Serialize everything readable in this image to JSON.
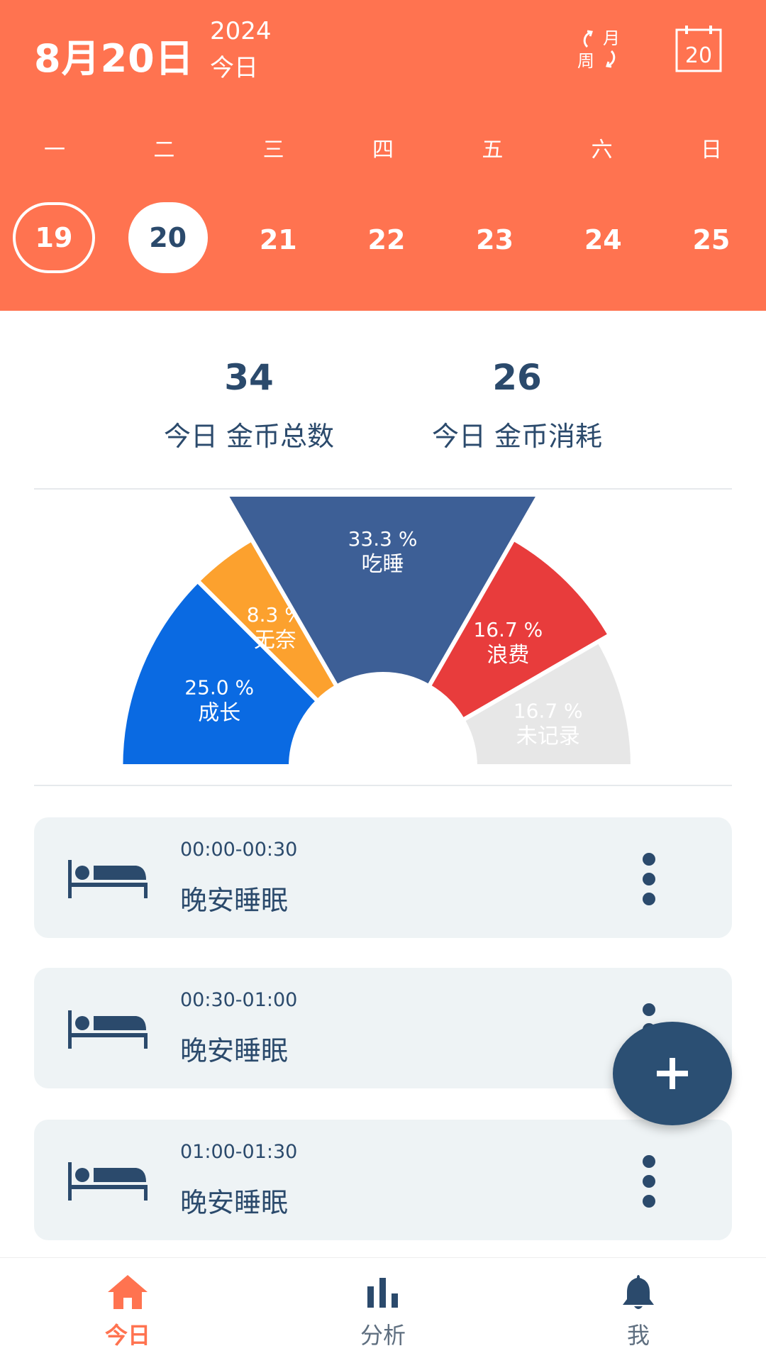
{
  "header": {
    "date": "8月20日",
    "year": "2024",
    "today": "今日",
    "switch_month": "月",
    "switch_week": "周",
    "calendar_day": "20",
    "weekdays": [
      "一",
      "二",
      "三",
      "四",
      "五",
      "六",
      "日"
    ],
    "dates": [
      "19",
      "20",
      "21",
      "22",
      "23",
      "24",
      "25"
    ]
  },
  "stats": {
    "total_value": "34",
    "total_label": "今日 金币总数",
    "spent_value": "26",
    "spent_label": "今日 金币消耗"
  },
  "chart_data": {
    "type": "pie",
    "shape": "half-donut",
    "slices": [
      {
        "label": "成长",
        "pct_text": "25.0 %",
        "value": 25.0,
        "color": "#0a6ae2"
      },
      {
        "label": "无奈",
        "pct_text": "8.3 %",
        "value": 8.3,
        "color": "#fca12e"
      },
      {
        "label": "吃睡",
        "pct_text": "33.3 %",
        "value": 33.3,
        "color": "#3d5f96"
      },
      {
        "label": "浪费",
        "pct_text": "16.7 %",
        "value": 16.7,
        "color": "#e83c3c"
      },
      {
        "label": "未记录",
        "pct_text": "16.7 %",
        "value": 16.7,
        "color": "#e7e7e7"
      }
    ]
  },
  "entries": [
    {
      "time": "00:00-00:30",
      "title": "晚安睡眠",
      "icon": "bed-icon"
    },
    {
      "time": "00:30-01:00",
      "title": "晚安睡眠",
      "icon": "bed-icon"
    },
    {
      "time": "01:00-01:30",
      "title": "晚安睡眠",
      "icon": "bed-icon"
    }
  ],
  "nav": {
    "items": [
      {
        "label": "今日",
        "icon": "home-icon"
      },
      {
        "label": "分析",
        "icon": "bar-chart-icon"
      },
      {
        "label": "我",
        "icon": "bell-icon"
      }
    ]
  },
  "colors": {
    "accent": "#ff7350",
    "primary": "#2b4a6c"
  }
}
